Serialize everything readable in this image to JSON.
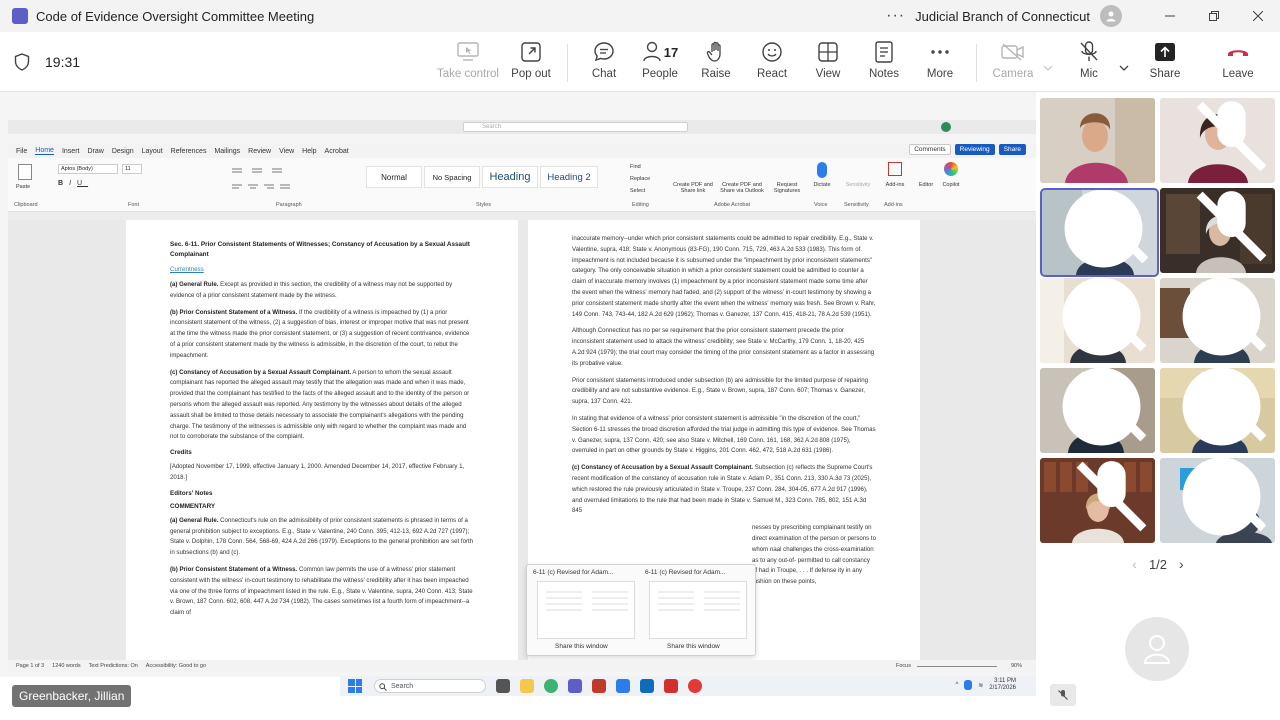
{
  "window": {
    "title": "Code of Evidence Oversight Committee Meeting",
    "org": "Judicial Branch of Connecticut",
    "minimize_icon": "minimize-icon",
    "maximize_icon": "restore-icon",
    "close_icon": "close-icon"
  },
  "toolbar": {
    "timer": "19:31",
    "buttons": {
      "take_control": "Take control",
      "pop_out": "Pop out",
      "chat": "Chat",
      "people": "People",
      "people_count": "17",
      "raise": "Raise",
      "react": "React",
      "view": "View",
      "notes": "Notes",
      "more": "More",
      "camera": "Camera",
      "mic": "Mic",
      "share": "Share",
      "leave": "Leave"
    },
    "accent": "#5b5fc7",
    "leave_color": "#c4314b"
  },
  "word": {
    "tabs": [
      "File",
      "Home",
      "Insert",
      "Draw",
      "Design",
      "Layout",
      "References",
      "Mailings",
      "Review",
      "View",
      "Help",
      "Acrobat"
    ],
    "active_tab": "Home",
    "search": "Search",
    "right_buttons": {
      "comments": "Comments",
      "reviewing": "Reviewing",
      "share": "Share"
    },
    "font_name": "Aptos (Body)",
    "font_size": "11",
    "styles": {
      "normal": "Normal",
      "no_spacing": "No Spacing",
      "heading1": "Heading",
      "heading2": "Heading 2"
    },
    "groups": {
      "clipboard": "Clipboard",
      "font": "Font",
      "paragraph": "Paragraph",
      "styles": "Styles",
      "editing": "Editing",
      "adobe": "Adobe Acrobat",
      "voice": "Voice",
      "sensitivity": "Sensitivity",
      "addins": "Add-ins"
    },
    "ribbon_items": {
      "paste": "Paste",
      "find": "Find",
      "replace": "Replace",
      "select": "Select",
      "create_pdf_share": "Create PDF and Share link",
      "create_pdf_outlook": "Create PDF and Share via Outlook",
      "request_signatures": "Request Signatures",
      "dictate": "Dictate",
      "sensitivity": "Sensitivity",
      "addins": "Add-ins",
      "editor": "Editor",
      "copilot": "Copilot"
    },
    "status": {
      "page": "Page 1 of 3",
      "words": "1240 words",
      "predictions": "Text Predictions: On",
      "accessibility": "Accessibility: Good to go",
      "focus": "Focus",
      "zoom": "90%"
    }
  },
  "document": {
    "left": {
      "heading": "Sec. 6-11. Prior Consistent Statements of Witnesses; Constancy of Accusation by a Sexual Assault Complainant",
      "link": "Currentness",
      "p1_label": "(a) General Rule.",
      "p1": "Except as provided in this section, the credibility of a witness may not be supported by evidence of a prior consistent statement made by the witness.",
      "p2_label": "(b) Prior Consistent Statement of a Witness.",
      "p2": "If the credibility of a witness is impeached by (1) a prior inconsistent statement of the witness, (2) a suggestion of bias, interest or improper motive that was not present at the time the witness made the prior consistent statement, or (3) a suggestion of recent contrivance, evidence of a prior consistent statement made by the witness is admissible, in the discretion of the court, to rebut the impeachment.",
      "p3_label": "(c) Constancy of Accusation by a Sexual Assault Complainant.",
      "p3": "A person to whom the sexual assault complainant has reported the alleged assault may testify that the allegation was made and when it was made, provided that the complainant has testified to the facts of the alleged assault and to the identity of the person or persons whom the alleged assault was reported. Any testimony by the witnesses about details of the alleged assault shall be limited to those details necessary to associate the complainant's allegations with the pending charge. The testimony of the witnesses is admissible only with regard to whether the complaint was made and not to corroborate the substance of the complaint.",
      "credits_title": "Credits",
      "credits": "[Adopted November 17, 1999, effective January 1, 2000. Amended December 14, 2017, effective February 1, 2018.]",
      "editors_title": "Editors' Notes",
      "commentary_title": "COMMENTARY",
      "c1_label": "(a) General Rule.",
      "c1": "Connecticut's rule on the admissibility of prior consistent statements is phrased in terms of a general prohibition subject to exceptions. E.g., State v. Valentine, 240 Conn. 395, 412-13, 692 A.2d 727 (1997); State v. Dolphin, 178 Conn. 564, 568-69, 424 A.2d 266 (1979). Exceptions to the general prohibition are set forth in subsections (b) and (c).",
      "c2_label": "(b) Prior Consistent Statement of a Witness.",
      "c2": "Common law permits the use of a witness' prior statement consistent with the witness' in-court testimony to rehabilitate the witness' credibility after it has been impeached via one of the three forms of impeachment listed in the rule. E.g., State v. Valentine, supra, 240 Conn. 413; State v. Brown, 187 Conn. 602, 608, 447 A.2d 734 (1982). The cases sometimes list a fourth form of impeachment--a claim of"
    },
    "right": {
      "r1": "inaccurate memory--under which prior consistent statements could be admitted to repair credibility. E.g., State v. Valentine, supra, 418; State v. Anonymous (83-FG), 190 Conn. 715, 729, 463 A.2d 533 (1983). This form of impeachment is not included because it is subsumed under the \"impeachment by prior inconsistent statements\" category. The only conceivable situation in which a prior consistent statement could be admitted to counter a claim of inaccurate memory involves (1) impeachment by a prior inconsistent statement made some time after the event when the witness' memory had faded, and (2) support of the witness' in-court testimony by showing a prior consistent statement made shortly after the event when the witness' memory was fresh. See Brown v. Rahr, 149 Conn. 743, 743-44, 182 A.2d 629 (1962); Thomas v. Ganezer, 137 Conn. 415, 418-21, 78 A.2d 539 (1951).",
      "r2": "Although Connecticut has no per se requirement that the prior consistent statement precede the prior inconsistent statement used to attack the witness' credibility; see State v. McCarthy, 179 Conn. 1, 18-20, 425 A.2d 924 (1979); the trial court may consider the timing of the prior consistent statement as a factor in assessing its probative value.",
      "r3": "Prior consistent statements introduced under subsection (b) are admissible for the limited purpose of repairing credibility and are not substantive evidence. E.g., State v. Brown, supra, 187 Conn. 607; Thomas v. Ganezer, supra, 137 Conn. 421.",
      "r4": "In stating that evidence of a witness' prior consistent statement is admissible \"in the discretion of the court,\" Section 6-11 stresses the broad discretion afforded the trial judge in admitting this type of evidence. See Thomas v. Ganezer, supra, 137 Conn. 420; see also State v. Mitchell, 169 Conn. 161, 168, 362 A.2d 808 (1975), overruled in part on other grounds by State v. Higgins, 201 Conn. 462, 472, 518 A.2d 631 (1986).",
      "r5_label": "(c) Constancy of Accusation by a Sexual Assault Complainant.",
      "r5": "Subsection (c) reflects the Supreme Court's recent modification of the constancy of accusation rule in State v. Adam P., 351 Conn. 213, 330 A.3d 73 (2025), which restored the rule previously articulated in State v. Troupe, 237 Conn. 284, 304-05, 677 A.2d 917 (1996), and overruled limitations to the rule that had been made in State v. Samuel M., 323 Conn. 785, 802, 151 A.3d 845",
      "r6": "nesses by prescribing complainant testify on direct examination of the person or persons to whom naal challenges the cross-examination as to any out-of- permitted to call constancy of had in Troupe, . . . If defense ity in any fashion on these points,"
    }
  },
  "share_popup": {
    "win1_title": "6-11 (c) Revised for Adam...",
    "win2_title": "6-11 (c) Revised for Adam...",
    "share_label": "Share this window"
  },
  "taskbar": {
    "search": "Search",
    "time": "3:11 PM",
    "date": "2/17/2026"
  },
  "presenter": "Greenbacker, Jillian",
  "gallery": {
    "page_indicator": "1/2"
  }
}
